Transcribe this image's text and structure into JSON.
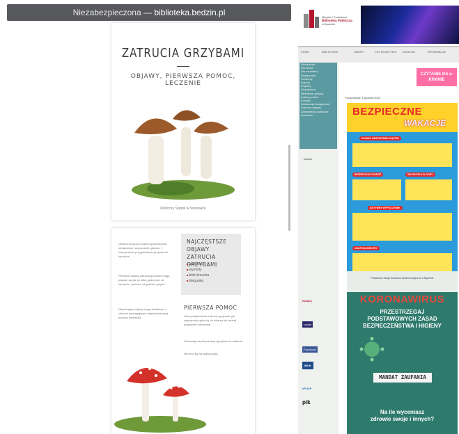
{
  "browser": {
    "security_label": "Niezabezpieczona",
    "separator": "—",
    "host": "biblioteka.bedzin.pl"
  },
  "document": {
    "page1": {
      "title": "ZATRUCIA GRZYBAMI",
      "subtitle": "OBJAWY, PIERWSZA POMOC, LECZENIE",
      "footer": "Kliniczny Szpital w Sosnowcu"
    },
    "page2": {
      "paragraphs": [
        "Główną przyczyną zatruć grzybami jest niewłaściwe rozpoznanie gatunku i niepoprawne przygotowanie grzybów do spożycia.",
        "Pierwsze objawy zatrucia grzybami mogą pojawić się już po kilku godzinach od spożycia, zależnie od gatunku grzyba.",
        "Niepokojące objawy mogą świadczyć o zatruciu wymagającym natychmiastowej pomocy lekarskiej."
      ],
      "common_symptoms_heading": "NAJCZĘSTSZE OBJAWY ZATRUCIA GRZYBAMI",
      "symptoms": [
        "nudności",
        "wymioty",
        "bóle brzucha",
        "biegunka"
      ],
      "first_aid_heading": "PIERWSZA POMOC",
      "first_aid_text": [
        "Jeśli podejrzewasz zatrucie grzybami, jak najszybciej zgłoś się do lekarza lub wezwij pogotowie ratunkowe.",
        "Zachowaj resztki potrawy i grzybów do badania.",
        "Nie lecz się na własną rękę."
      ]
    }
  },
  "site": {
    "logo_line1": "Miejska i Powiatowa",
    "logo_line2": "Biblioteka Publiczna",
    "logo_line3": "w Będzinie",
    "nav": [
      "START",
      "BIBLIOTEKA",
      "ZBIORY",
      "CZYTELNICTWO",
      "KATALOG",
      "INFORMACJE"
    ],
    "sidebar_items": [
      "Aktualności",
      "Dla dzieci",
      "Dla młodzieży",
      "Wydarzenia",
      "Konkursy",
      "Galeria",
      "Projekty",
      "Współpraca",
      "Biblioteka cyfrowa",
      "Katalog online",
      "Kontakt",
      "Deklaracja dostępności",
      "Ochrona danych",
      "Zamówienia publiczne",
      "Archiwum"
    ],
    "banner_e": "CZYTANIE NA e-KRANIE",
    "date": "Rozpoczęto: 4 grudnia 2020",
    "wakacje": {
      "title": "BEZPIECZNE",
      "subtitle": "WAKACJE",
      "badges": [
        "ZASADY BEZPIECZNEJ KĄPIELI",
        "BEZPIECZNA PODRÓŻ",
        "WYCIECZKA W GÓRY",
        "AKTYWNY WYPOCZYNEK",
        "UDAR SŁONECZNY"
      ],
      "emergency_number": "112"
    },
    "covid": {
      "header": "Powiatowa Stacja Sanitarno-Epidemiologiczna w Będzinie",
      "title": "KORONAWIRUS",
      "subtitle_line1": "PRZESTRZEGAJ",
      "subtitle_line2": "PODSTAWOWYCH ZASAD",
      "subtitle_line3": "BEZPIECZEŃSTWA I HIGIENY",
      "mandate": "MANDAT ZAUFANIA",
      "question_line1": "Na ile wyceniasz",
      "question_line2": "zdrowie swoje i innych?"
    },
    "left_logos": [
      "Będzin",
      "Kultury",
      "czytak",
      "Facebook",
      "IBUK",
      "ePUAP",
      "pik"
    ]
  },
  "colors": {
    "urlbar": "#58595c",
    "sidebar": "#5a9aa0",
    "wakacje_bg": "#2b9bdc",
    "wakacje_title": "#e62926",
    "covid_bg": "#2e7a6c",
    "covid_title": "#e3493d"
  }
}
